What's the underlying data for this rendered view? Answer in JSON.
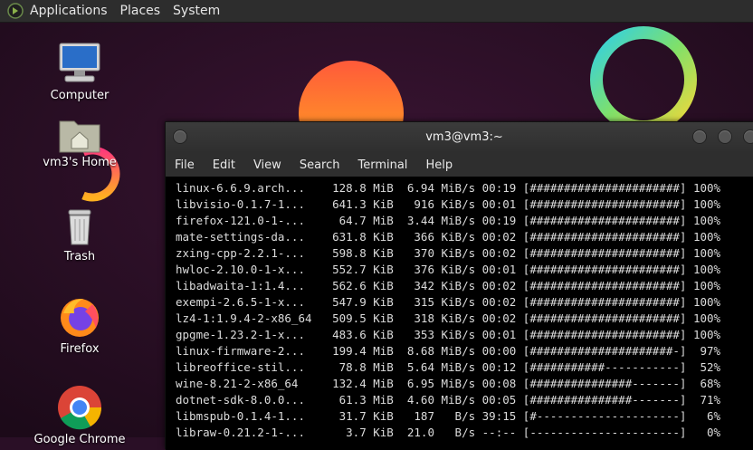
{
  "panel": {
    "menus": [
      "Applications",
      "Places",
      "System"
    ]
  },
  "desktop": {
    "icons": [
      {
        "label": "Computer"
      },
      {
        "label": "vm3's Home"
      },
      {
        "label": "Trash"
      },
      {
        "label": "Firefox"
      },
      {
        "label": "Google Chrome"
      }
    ]
  },
  "terminal": {
    "title": "vm3@vm3:~",
    "menu": [
      "File",
      "Edit",
      "View",
      "Search",
      "Terminal",
      "Help"
    ],
    "lines": [
      "linux-6.6.9.arch...    128.8 MiB  6.94 MiB/s 00:19 [######################] 100%",
      "libvisio-0.1.7-1...    641.3 KiB   916 KiB/s 00:01 [######################] 100%",
      "firefox-121.0-1-...     64.7 MiB  3.44 MiB/s 00:19 [######################] 100%",
      "mate-settings-da...    631.8 KiB   366 KiB/s 00:02 [######################] 100%",
      "zxing-cpp-2.2.1-...    598.8 KiB   370 KiB/s 00:02 [######################] 100%",
      "hwloc-2.10.0-1-x...    552.7 KiB   376 KiB/s 00:01 [######################] 100%",
      "libadwaita-1:1.4...    562.6 KiB   342 KiB/s 00:02 [######################] 100%",
      "exempi-2.6.5-1-x...    547.9 KiB   315 KiB/s 00:02 [######################] 100%",
      "lz4-1:1.9.4-2-x86_64   509.5 KiB   318 KiB/s 00:02 [######################] 100%",
      "gpgme-1.23.2-1-x...    483.6 KiB   353 KiB/s 00:01 [######################] 100%",
      "linux-firmware-2...    199.4 MiB  8.68 MiB/s 00:00 [#####################-]  97%",
      "libreoffice-stil...     78.8 MiB  5.64 MiB/s 00:12 [###########-----------]  52%",
      "wine-8.21-2-x86_64     132.4 MiB  6.95 MiB/s 00:08 [###############-------]  68%",
      "dotnet-sdk-8.0.0...     61.3 MiB  4.60 MiB/s 00:05 [###############-------]  71%",
      "libmspub-0.1.4-1...     31.7 KiB   187   B/s 39:15 [#---------------------]   6%",
      "libraw-0.21.2-1-...      3.7 KiB  21.0   B/s --:-- [----------------------]   0%"
    ]
  }
}
